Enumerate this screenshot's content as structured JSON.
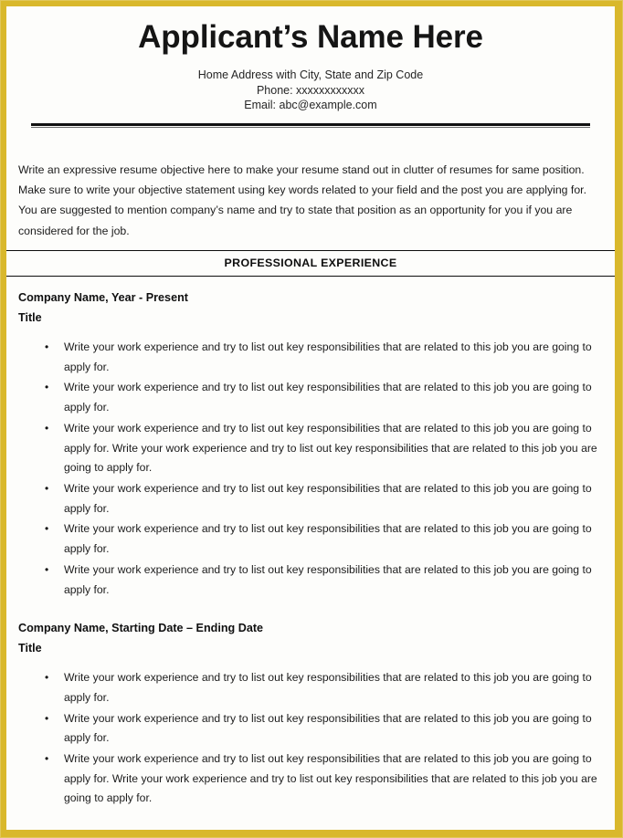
{
  "theme": {
    "frame_color": "#d9b82c",
    "page_background": "#fdfdfb",
    "text_color": "#1c1c1c",
    "rule_color": "#0d0d0d"
  },
  "header": {
    "applicant_name": "Applicant’s Name Here",
    "address": "Home Address with City, State and Zip Code",
    "phone": "Phone: xxxxxxxxxxxx",
    "email": "Email: abc@example.com"
  },
  "objective": {
    "text": "Write an expressive resume objective here to make your resume stand out in clutter of resumes for same position. Make sure to write your objective statement using key words related to your field and the post you are applying for. You are suggested to mention company’s name and try to state that position as an opportunity for you if you are considered for the job."
  },
  "sections": {
    "professional_experience": {
      "heading": "PROFESSIONAL EXPERIENCE",
      "jobs": [
        {
          "company": "Company Name, Year - Present",
          "title": "Title",
          "bullets": [
            "Write your work experience and try to list out key responsibilities that are related to this job you are going to apply for.",
            "Write your work experience and try to list out key responsibilities that are related to this job you are going to apply for.",
            "Write your work experience and try to list out key responsibilities that are related to this job you are going to apply for. Write your work experience and try to list out key responsibilities that are related to this job you are going to apply for.",
            "Write your work experience and try to list out key responsibilities that are related to this job you are going to apply for.",
            "Write your work experience and try to list out key responsibilities that are related to this job you are going to apply for.",
            "Write your work experience and try to list out key responsibilities that are related to this job you are going to apply for."
          ]
        },
        {
          "company": "Company Name, Starting Date – Ending Date",
          "title": "Title",
          "bullets": [
            "Write your work experience and try to list out key responsibilities that are related to this job you are going to apply for.",
            "Write your work experience and try to list out key responsibilities that are related to this job you are going to apply for.",
            "Write your work experience and try to list out key responsibilities that are related to this job you are going to apply for. Write your work experience and try to list out key responsibilities that are related to this job you are going to apply for."
          ]
        }
      ]
    }
  },
  "bullet_glyph": "•"
}
